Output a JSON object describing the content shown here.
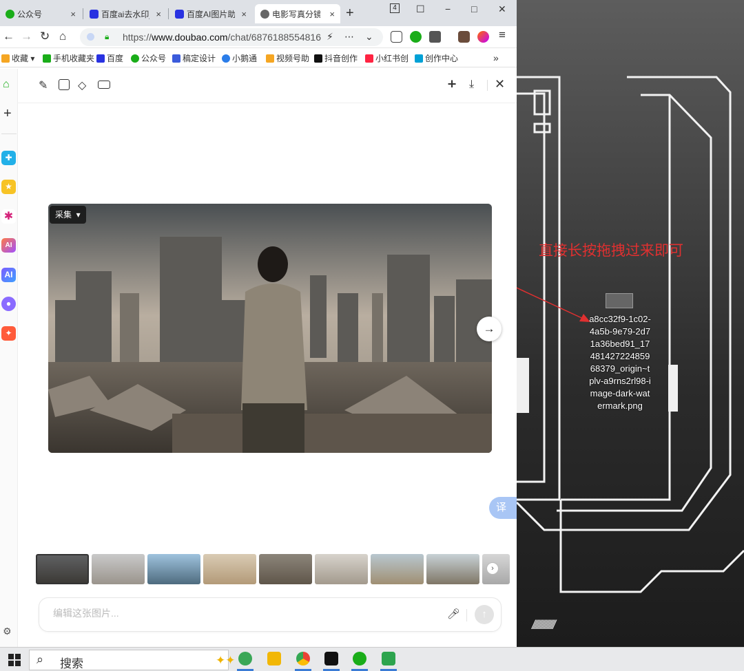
{
  "tabs": [
    {
      "label": "公众号",
      "favicon": "wechat-mp-icon",
      "color": "#1aad19"
    },
    {
      "label": "百度ai去水印_",
      "favicon": "baidu-paw-icon",
      "color": "#2932e1"
    },
    {
      "label": "百度AI图片助手",
      "favicon": "baidu-paw-icon",
      "color": "#2932e1"
    },
    {
      "label": "电影写真分镜",
      "favicon": "doubao-icon",
      "color": "#555"
    }
  ],
  "tab_close": "×",
  "tab_count": "4",
  "new_tab": "+",
  "url": {
    "prefix": "https://",
    "host": "www.doubao.com",
    "path": "/chat/6876188554816"
  },
  "bookmarks": [
    {
      "label": "收藏",
      "color": "#f5a623"
    },
    {
      "label": "手机收藏夹",
      "color": "#1aad19"
    },
    {
      "label": "百度",
      "color": "#2932e1"
    },
    {
      "label": "公众号",
      "color": "#1aad19"
    },
    {
      "label": "稿定设计",
      "color": "#3b5bdb"
    },
    {
      "label": "小鹅通",
      "color": "#2b7de9"
    },
    {
      "label": "视频号助",
      "color": "#f5a623"
    },
    {
      "label": "抖音创作",
      "color": "#111"
    },
    {
      "label": "小红书创",
      "color": "#ff2442"
    },
    {
      "label": "创作中心",
      "color": "#00a1d6"
    }
  ],
  "bookmarks_more": "»",
  "editor": {
    "collect_label": "采集",
    "input_placeholder": "编辑这张图片...",
    "translate_label": "译"
  },
  "desktop": {
    "annotation": "直接长按拖拽过来即可",
    "filename": "a8cc32f9-1c02-4a5b-9e79-2d71a36bed91_17481427224859 68379_origin~tplv-a9rns2rl98-image-dark-watermark.png",
    "accent": "#e03030"
  },
  "taskbar": {
    "search_label": "搜索"
  }
}
